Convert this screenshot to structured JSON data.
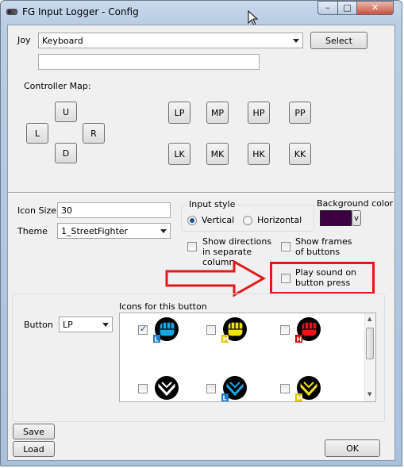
{
  "window": {
    "title": "FG Input Logger - Config",
    "controls": [
      "–",
      "□",
      "✕"
    ]
  },
  "joy": {
    "label": "Joy",
    "selected": "Keyboard",
    "select_label": "Select",
    "text_value": ""
  },
  "controller_map": {
    "label": "Controller Map:",
    "directions": {
      "up": "U",
      "left": "L",
      "right": "R",
      "down": "D"
    },
    "top_row": [
      "LP",
      "MP",
      "HP",
      "PP"
    ],
    "bottom_row": [
      "LK",
      "MK",
      "HK",
      "KK"
    ]
  },
  "icon_size": {
    "label": "Icon Size",
    "value": "30"
  },
  "theme": {
    "label": "Theme",
    "selected": "1_StreetFighter"
  },
  "input_style": {
    "title": "Input style",
    "options": [
      "Vertical",
      "Horizontal"
    ],
    "selected": "Vertical"
  },
  "background_color": {
    "label": "Background color",
    "swatch": "#3a0040",
    "button_label": "v"
  },
  "options": {
    "show_directions": "Show directions in separate column",
    "show_frames": "Show frames of buttons",
    "play_sound": "Play sound on button press"
  },
  "button_config": {
    "button_label": "Button",
    "button_selected": "LP",
    "icons_label": "Icons for this button",
    "icons": [
      {
        "name": "fist-blue-l-icon",
        "color": "#17a6e6",
        "badge": "L",
        "badge_color": "#1a7ad0",
        "checked": true
      },
      {
        "name": "fist-yellow-m-icon",
        "color": "#f2e21b",
        "badge": "M",
        "badge_color": "#e0c400",
        "checked": false
      },
      {
        "name": "fist-red-h-icon",
        "color": "#e81616",
        "badge": "H",
        "badge_color": "#d00000",
        "checked": false
      },
      {
        "name": "fist-white-icon",
        "color": "#ffffff",
        "badge": "",
        "badge_color": "",
        "checked": false
      },
      {
        "name": "kick-blue-l-icon",
        "color": "#17a6e6",
        "badge": "L",
        "badge_color": "#1a7ad0",
        "checked": false
      },
      {
        "name": "kick-yellow-m-icon",
        "color": "#f2e21b",
        "badge": "M",
        "badge_color": "#e0c400",
        "checked": false
      }
    ]
  },
  "footer": {
    "save": "Save",
    "load": "Load",
    "ok": "OK"
  },
  "annotation": {
    "arrow_color": "#e01a1a"
  }
}
